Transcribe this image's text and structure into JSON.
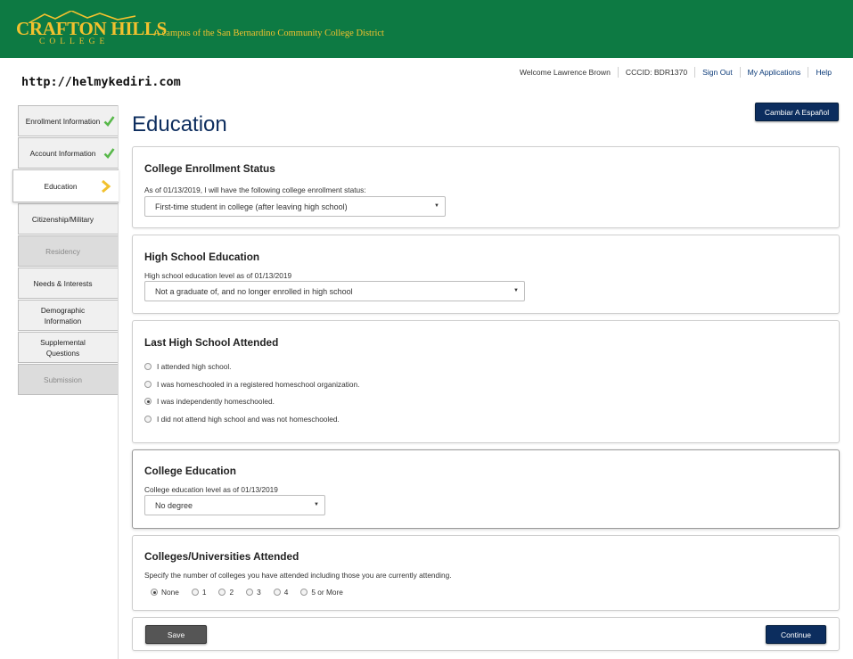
{
  "header": {
    "logo_main": "CRAFTON HILLS",
    "logo_sub": "COLLEGE",
    "tagline": "A campus of the San Bernardino Community College District",
    "brand_color": "#0d7a43",
    "accent_color": "#f2c12e"
  },
  "watermark": "http://helmykediri.com",
  "util_nav": {
    "welcome": "Welcome Lawrence Brown",
    "ccc_id": "CCCID: BDR1370",
    "sign_out": "Sign Out",
    "my_applications": "My Applications",
    "help": "Help"
  },
  "sidebar": {
    "items": [
      {
        "label": "Enrollment Information",
        "state": "complete",
        "icon": "check-icon"
      },
      {
        "label": "Account Information",
        "state": "complete",
        "icon": "check-icon"
      },
      {
        "label": "Education",
        "state": "active",
        "icon": "chevron-right-icon"
      },
      {
        "label": "Citizenship/Military",
        "state": "enabled"
      },
      {
        "label": "Residency",
        "state": "disabled"
      },
      {
        "label": "Needs & Interests",
        "state": "enabled"
      },
      {
        "label": "Demographic Information",
        "state": "enabled"
      },
      {
        "label": "Supplemental Questions",
        "state": "enabled"
      },
      {
        "label": "Submission",
        "state": "disabled"
      }
    ]
  },
  "main": {
    "title": "Education",
    "language_button": "Cambiar A Español",
    "college_enrollment": {
      "heading": "College Enrollment Status",
      "question": "As of 01/13/2019, I will have the following college enrollment status:",
      "selected": "First-time student in college (after leaving high school)"
    },
    "high_school_education": {
      "heading": "High School Education",
      "question": "High school education level as of 01/13/2019",
      "selected": "Not a graduate of, and no longer enrolled in high school"
    },
    "last_high_school": {
      "heading": "Last High School Attended",
      "options": [
        {
          "label": "I attended high school.",
          "checked": false
        },
        {
          "label": "I was homeschooled in a registered homeschool organization.",
          "checked": false
        },
        {
          "label": "I was independently homeschooled.",
          "checked": true
        },
        {
          "label": "I did not attend high school and was not homeschooled.",
          "checked": false
        }
      ]
    },
    "college_education": {
      "heading": "College Education",
      "question": "College education level as of 01/13/2019",
      "selected": "No degree"
    },
    "colleges_attended": {
      "heading": "Colleges/Universities Attended",
      "question": "Specify the number of colleges you have attended including those you are currently attending.",
      "options": [
        {
          "label": "None",
          "checked": true
        },
        {
          "label": "1",
          "checked": false
        },
        {
          "label": "2",
          "checked": false
        },
        {
          "label": "3",
          "checked": false
        },
        {
          "label": "4",
          "checked": false
        },
        {
          "label": "5 or More",
          "checked": false
        }
      ]
    },
    "actions": {
      "save": "Save",
      "continue": "Continue"
    }
  }
}
